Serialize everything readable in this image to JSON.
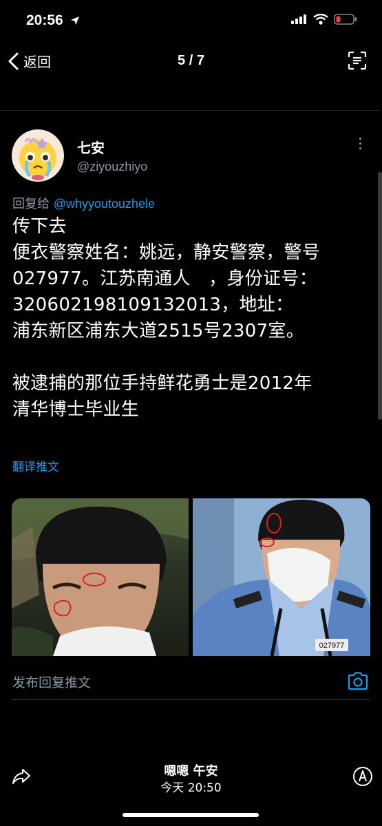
{
  "status_bar": {
    "time": "20:56"
  },
  "nav": {
    "back_label": "返回",
    "page_indicator": "5 / 7"
  },
  "tweet": {
    "author_name": "七安",
    "author_handle": "@ziyouzhiyo",
    "reply_prefix": "回复给 ",
    "reply_handle": "@whyyoutouzhele",
    "body": "传下去\n便衣警察姓名：姚远，静安警察，警号\n027977。江苏南通人　，身份证号：\n320602198109132013，地址：\n浦东新区浦东大道2515号2307室。\n\n被逮捕的那位手持鲜花勇士是2012年\n清华博士毕业生",
    "translate_label": "翻译推文",
    "badge_number": "027977"
  },
  "compose": {
    "placeholder": "发布回复推文"
  },
  "footer": {
    "title": "嗯嗯 午安",
    "time": "今天 20:50"
  },
  "colors": {
    "accent": "#1d9bf0",
    "muted": "#8b98a5",
    "background": "#000000"
  }
}
